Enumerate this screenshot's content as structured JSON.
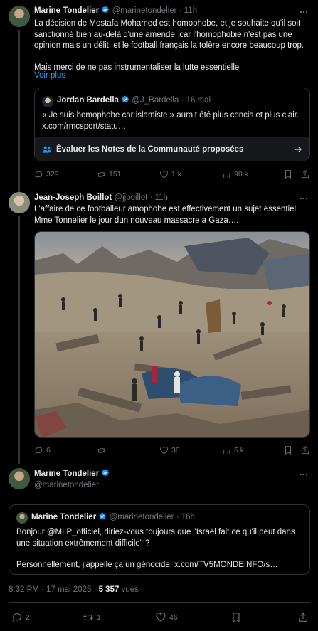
{
  "tweet1": {
    "name": "Marine Tondelier",
    "handle": "@marinetondelier",
    "time": "· 11h",
    "text_line1": "La décision de Mostafa Mohamed est homophobe, et je souhaite qu'il soit",
    "text_line2": "sanctionné bien au-delà d'une amende, car l'homophobie n'est pas une",
    "text_line3": "opinion mais un délit, et le football français la tolère encore beaucoup trop.",
    "text_line4": "Mais merci de ne pas instrumentaliser la lutte essentielle",
    "show_more": "Voir plus",
    "quote": {
      "name": "Jordan Bardella",
      "handle": "@J_Bardella",
      "time": "· 16 mai",
      "text_line1": "« Je suis homophobe car islamiste » aurait été plus concis et plus clair.",
      "text_line2": "x.com/rmcsport/statu…",
      "community_notes": "Évaluer les Notes de la Communauté proposées"
    },
    "replies": "329",
    "reposts": "151",
    "likes": "1 k",
    "views": "90 k"
  },
  "tweet2": {
    "name": "Jean-Joseph Boillot",
    "handle": "@jjboillot",
    "time": "· 11h",
    "text_line1": "L'affaire de ce footballeur amophobe est effectivement un sujet essentiel",
    "text_line2": "Mme Tonnelier le jour dun nouveau massacre a Gaza….",
    "replies": "6",
    "reposts": "",
    "likes": "30",
    "views": "5 k"
  },
  "tweet3": {
    "name": "Marine Tondelier",
    "handle": "@marinetondelier",
    "quote": {
      "name": "Marine Tondelier",
      "handle": "@marinetondelier",
      "time": "· 16h",
      "text_line1": "Bonjour @MLP_officiel, diriez-vous toujours que \"Israël fait ce qu'il peut dans",
      "text_line2": "une situation extrêmement difficile\" ?",
      "text_line3": "Personnellement, j'appelle ça un génocide. x.com/TV5MONDEINFO/s…"
    },
    "timestamp": "8:32 PM · 17 mai 2025 ·",
    "views_count": "5 357",
    "views_label": "vues",
    "replies": "2",
    "reposts": "1",
    "likes": "46"
  },
  "colors": {
    "accent": "#1d9bf0",
    "verified": "#1d9bf0",
    "background": "#000000",
    "text": "#e7e9ea",
    "muted": "#71767b"
  }
}
